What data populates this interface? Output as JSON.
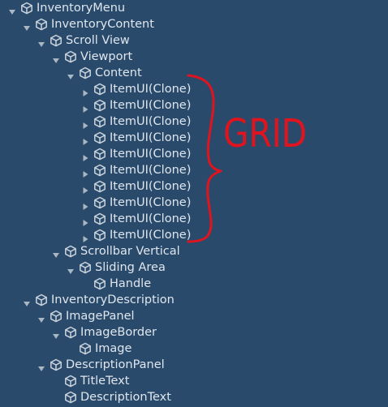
{
  "hierarchy": {
    "rows": [
      {
        "label": "InventoryMenu",
        "depth": 0,
        "arrow": "expanded"
      },
      {
        "label": "InventoryContent",
        "depth": 1,
        "arrow": "expanded"
      },
      {
        "label": "Scroll View",
        "depth": 2,
        "arrow": "expanded"
      },
      {
        "label": "Viewport",
        "depth": 3,
        "arrow": "expanded"
      },
      {
        "label": "Content",
        "depth": 4,
        "arrow": "expanded"
      },
      {
        "label": "ItemUI(Clone)",
        "depth": 5,
        "arrow": "collapsed"
      },
      {
        "label": "ItemUI(Clone)",
        "depth": 5,
        "arrow": "collapsed"
      },
      {
        "label": "ItemUI(Clone)",
        "depth": 5,
        "arrow": "collapsed"
      },
      {
        "label": "ItemUI(Clone)",
        "depth": 5,
        "arrow": "collapsed"
      },
      {
        "label": "ItemUI(Clone)",
        "depth": 5,
        "arrow": "collapsed"
      },
      {
        "label": "ItemUI(Clone)",
        "depth": 5,
        "arrow": "collapsed"
      },
      {
        "label": "ItemUI(Clone)",
        "depth": 5,
        "arrow": "collapsed"
      },
      {
        "label": "ItemUI(Clone)",
        "depth": 5,
        "arrow": "collapsed"
      },
      {
        "label": "ItemUI(Clone)",
        "depth": 5,
        "arrow": "collapsed"
      },
      {
        "label": "ItemUI(Clone)",
        "depth": 5,
        "arrow": "collapsed"
      },
      {
        "label": "Scrollbar Vertical",
        "depth": 3,
        "arrow": "expanded"
      },
      {
        "label": "Sliding Area",
        "depth": 4,
        "arrow": "expanded"
      },
      {
        "label": "Handle",
        "depth": 5,
        "arrow": "none"
      },
      {
        "label": "InventoryDescription",
        "depth": 1,
        "arrow": "expanded"
      },
      {
        "label": "ImagePanel",
        "depth": 2,
        "arrow": "expanded"
      },
      {
        "label": "ImageBorder",
        "depth": 3,
        "arrow": "expanded"
      },
      {
        "label": "Image",
        "depth": 4,
        "arrow": "none"
      },
      {
        "label": "DescriptionPanel",
        "depth": 2,
        "arrow": "expanded"
      },
      {
        "label": "TitleText",
        "depth": 3,
        "arrow": "none"
      },
      {
        "label": "DescriptionText",
        "depth": 3,
        "arrow": "none"
      }
    ]
  },
  "annotation": {
    "text": "GRID",
    "color": "#e0141e"
  },
  "colors": {
    "background": "#2a4a6b",
    "text": "#dfe6ee",
    "icon": "#c9d3dd",
    "arrow": "#a9b6c3"
  }
}
